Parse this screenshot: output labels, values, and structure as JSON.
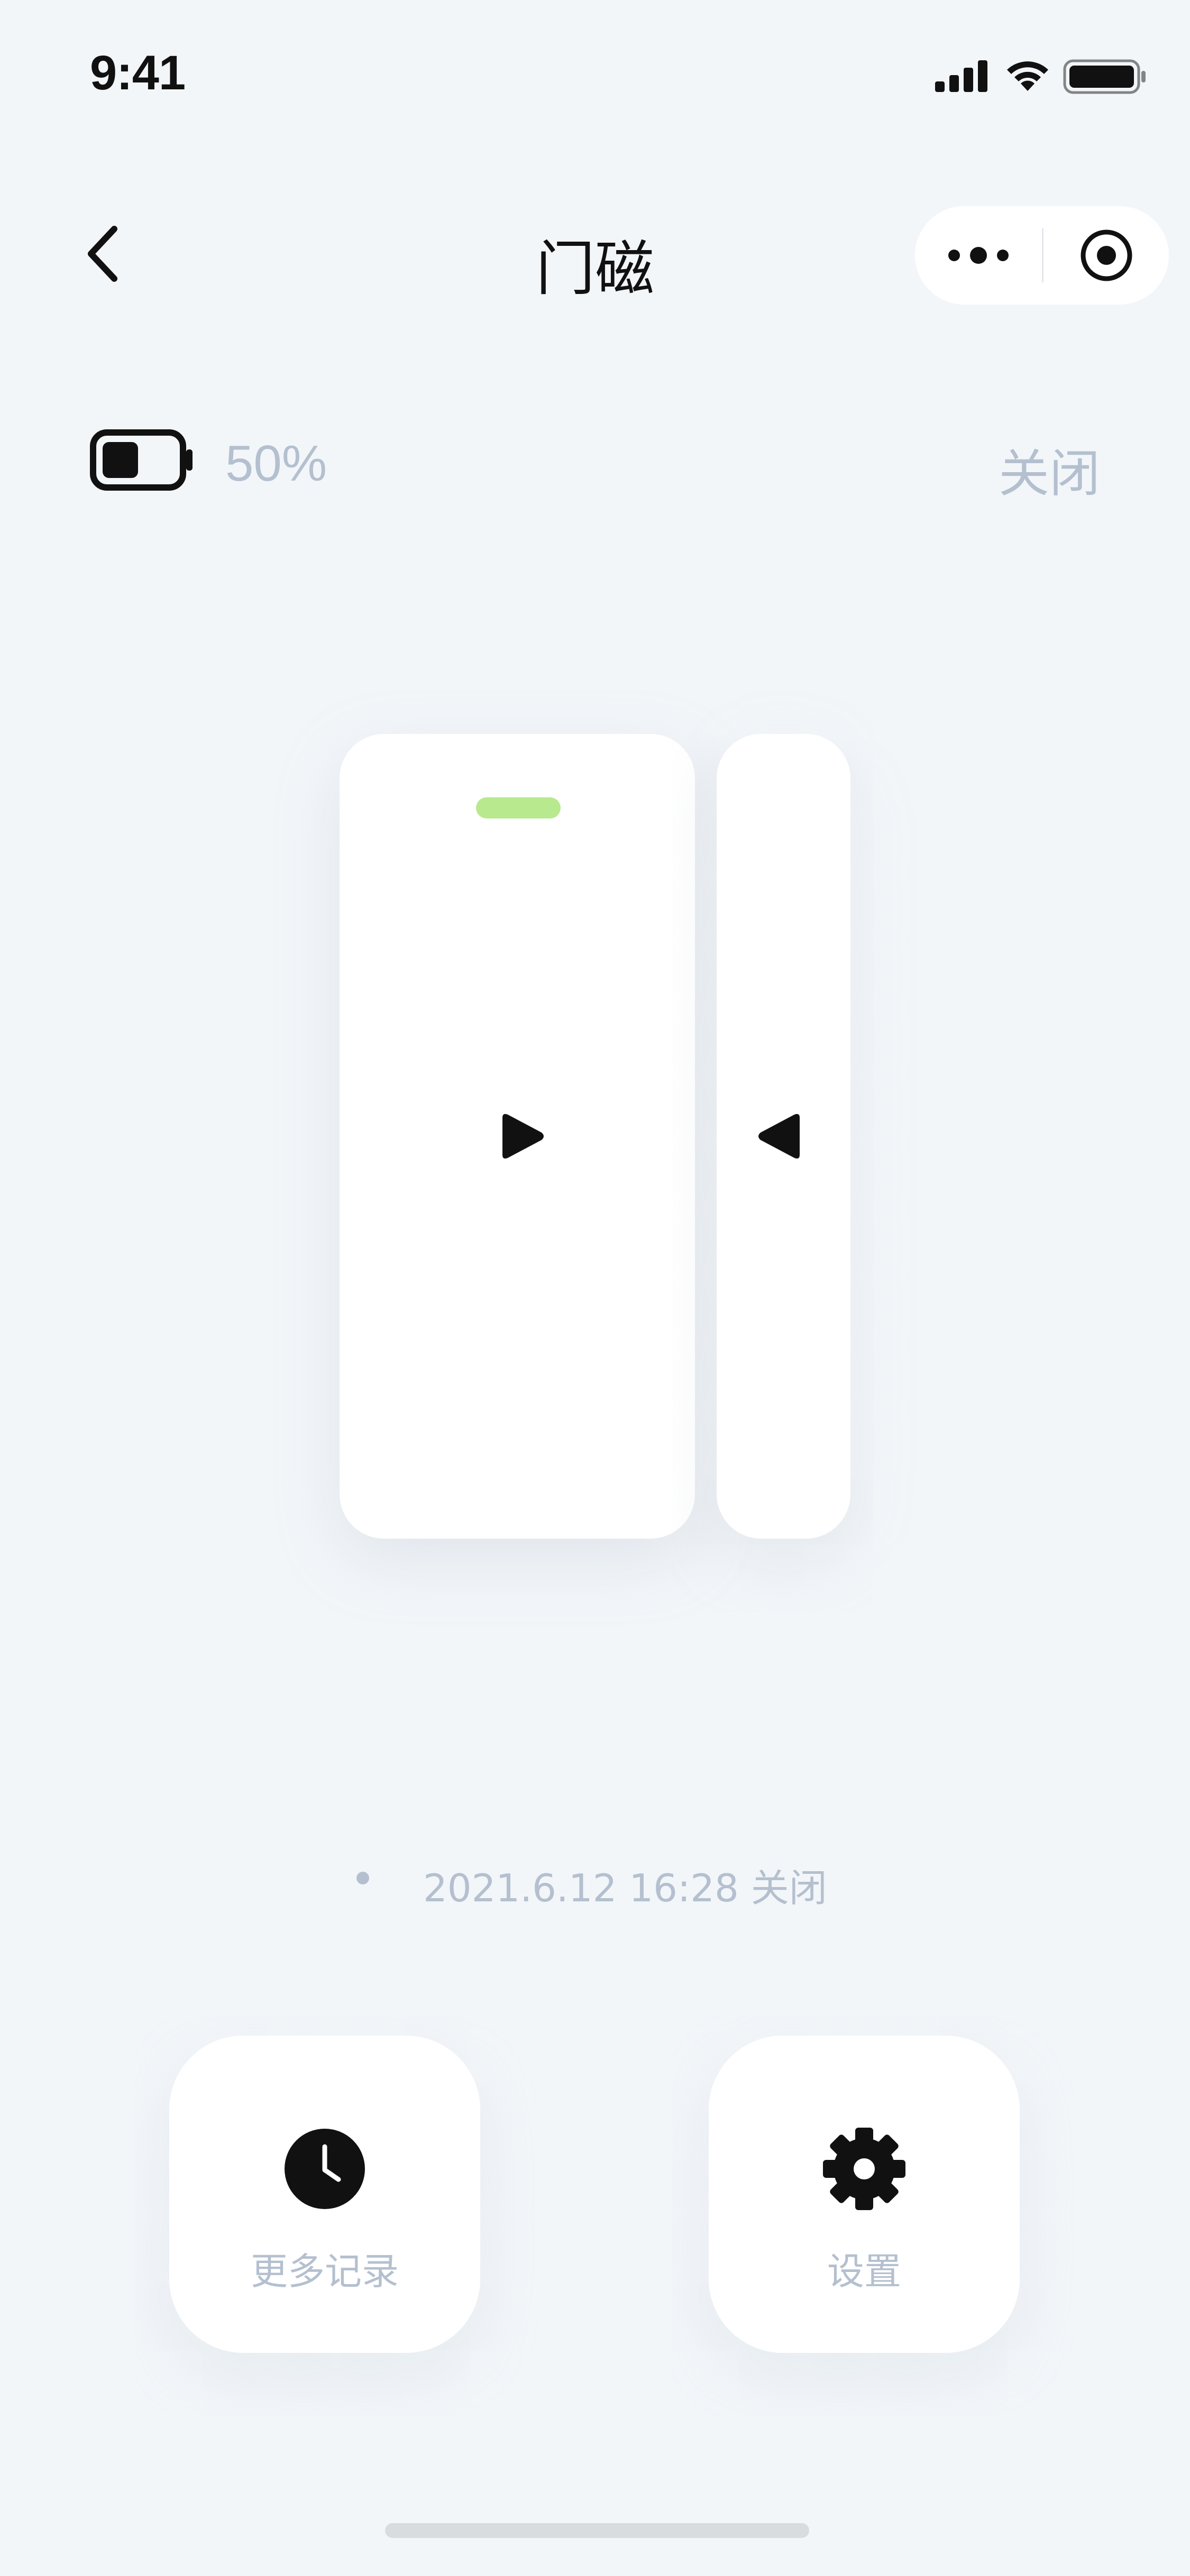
{
  "status_bar": {
    "time": "9:41"
  },
  "nav": {
    "title": "门磁"
  },
  "battery": {
    "percent_text": "50%",
    "level": 0.5
  },
  "door": {
    "state_label": "关闭"
  },
  "record": {
    "text": "2021.6.12 16:28 关闭"
  },
  "actions": {
    "history_label": "更多记录",
    "settings_label": "设置"
  },
  "colors": {
    "background": "#f3f6f9",
    "muted_text": "#b4c0cf",
    "indicator_green": "#b8e98e",
    "icon_dark": "#111111"
  }
}
